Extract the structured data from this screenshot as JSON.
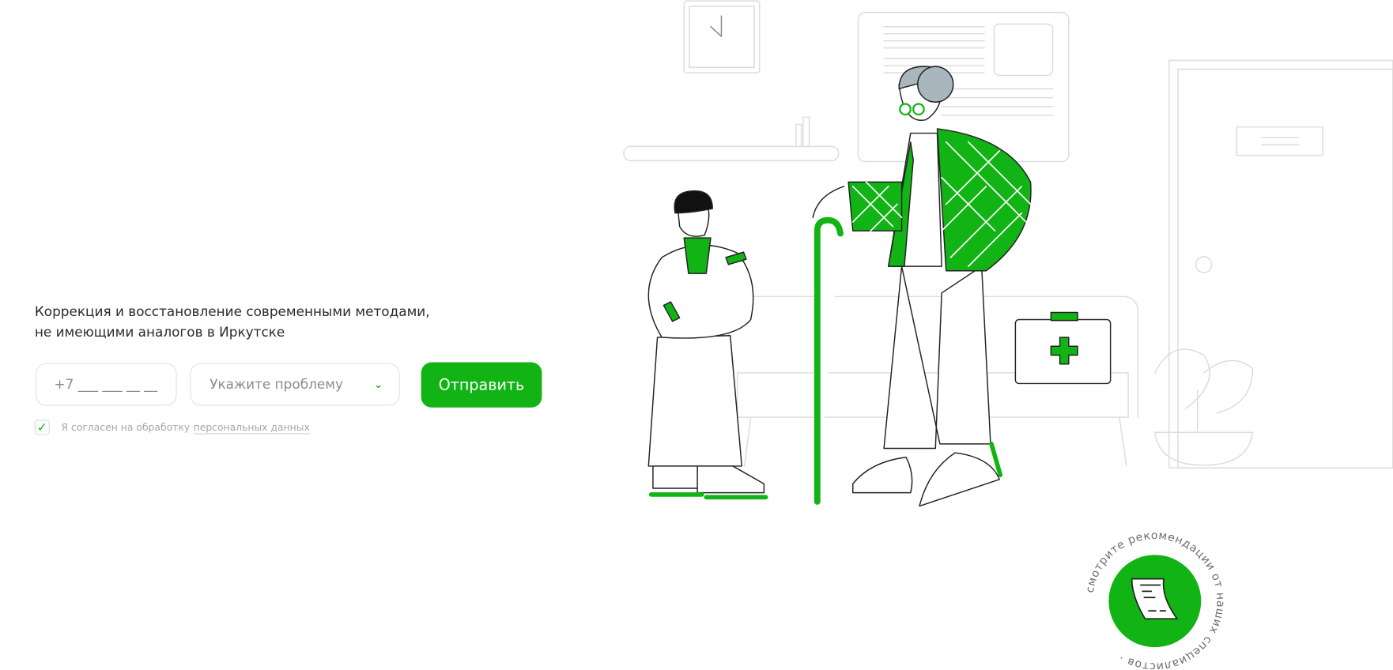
{
  "hero": {
    "heading_line1": "Коррекция и восстановление современными методами,",
    "heading_line2": "не имеющими аналогов в Иркутске"
  },
  "form": {
    "phone_placeholder": "+7 ___ ___ __ __",
    "problem_placeholder": "Укажите проблему",
    "submit_label": "Отправить",
    "consent_checked": true,
    "consent_text": "Я согласен на обработку",
    "consent_link": "персональных данных"
  },
  "badge": {
    "circular_text": "смотрите рекомендации от наших специалистов · ",
    "icon": "document-scroll-icon"
  },
  "colors": {
    "accent": "#12b315",
    "text": "#2b2b2b",
    "muted": "#a6a6a6",
    "line": "#e2e2e2"
  }
}
